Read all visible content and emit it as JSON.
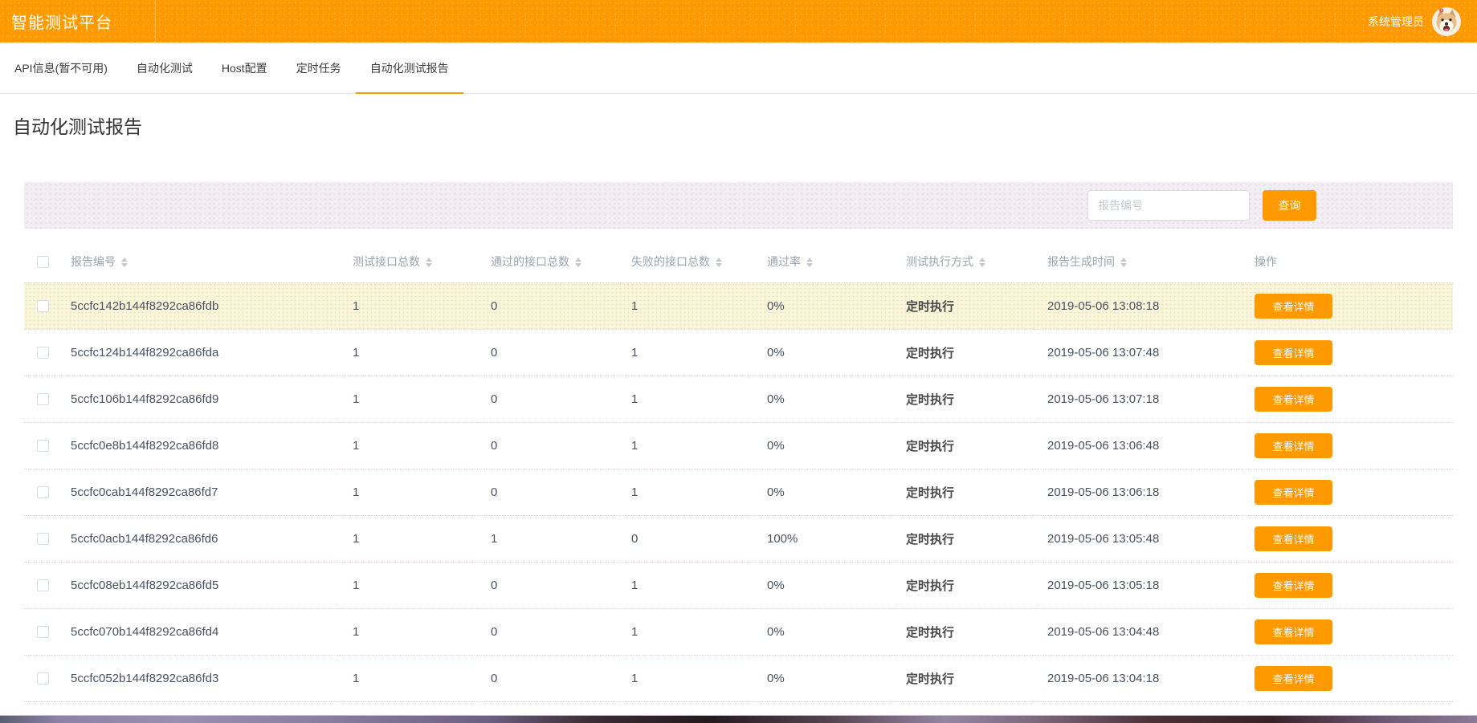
{
  "header": {
    "app_title": "智能测试平台",
    "user_name": "系统管理员",
    "avatar_icon": "dog-avatar"
  },
  "tabs": [
    {
      "label": "API信息(暂不可用)",
      "active": false
    },
    {
      "label": "自动化测试",
      "active": false
    },
    {
      "label": "Host配置",
      "active": false
    },
    {
      "label": "定时任务",
      "active": false
    },
    {
      "label": "自动化测试报告",
      "active": true
    }
  ],
  "page": {
    "title": "自动化测试报告"
  },
  "filter": {
    "input_placeholder": "报告编号",
    "input_value": "",
    "search_button_label": "查询"
  },
  "table": {
    "columns": [
      {
        "label": "报告编号",
        "sortable": true
      },
      {
        "label": "测试接口总数",
        "sortable": true
      },
      {
        "label": "通过的接口总数",
        "sortable": true
      },
      {
        "label": "失败的接口总数",
        "sortable": true
      },
      {
        "label": "通过率",
        "sortable": true
      },
      {
        "label": "测试执行方式",
        "sortable": true
      },
      {
        "label": "报告生成时间",
        "sortable": true
      },
      {
        "label": "操作",
        "sortable": false
      }
    ],
    "action_label": "查看详情",
    "rows": [
      {
        "id": "5ccfc142b144f8292ca86fdb",
        "total": "1",
        "passed": "0",
        "failed": "1",
        "rate": "0%",
        "exec": "定时执行",
        "time": "2019-05-06 13:08:18",
        "highlighted": true
      },
      {
        "id": "5ccfc124b144f8292ca86fda",
        "total": "1",
        "passed": "0",
        "failed": "1",
        "rate": "0%",
        "exec": "定时执行",
        "time": "2019-05-06 13:07:48",
        "highlighted": false
      },
      {
        "id": "5ccfc106b144f8292ca86fd9",
        "total": "1",
        "passed": "0",
        "failed": "1",
        "rate": "0%",
        "exec": "定时执行",
        "time": "2019-05-06 13:07:18",
        "highlighted": false
      },
      {
        "id": "5ccfc0e8b144f8292ca86fd8",
        "total": "1",
        "passed": "0",
        "failed": "1",
        "rate": "0%",
        "exec": "定时执行",
        "time": "2019-05-06 13:06:48",
        "highlighted": false
      },
      {
        "id": "5ccfc0cab144f8292ca86fd7",
        "total": "1",
        "passed": "0",
        "failed": "1",
        "rate": "0%",
        "exec": "定时执行",
        "time": "2019-05-06 13:06:18",
        "highlighted": false
      },
      {
        "id": "5ccfc0acb144f8292ca86fd6",
        "total": "1",
        "passed": "1",
        "failed": "0",
        "rate": "100%",
        "exec": "定时执行",
        "time": "2019-05-06 13:05:48",
        "highlighted": false
      },
      {
        "id": "5ccfc08eb144f8292ca86fd5",
        "total": "1",
        "passed": "0",
        "failed": "1",
        "rate": "0%",
        "exec": "定时执行",
        "time": "2019-05-06 13:05:18",
        "highlighted": false
      },
      {
        "id": "5ccfc070b144f8292ca86fd4",
        "total": "1",
        "passed": "0",
        "failed": "1",
        "rate": "0%",
        "exec": "定时执行",
        "time": "2019-05-06 13:04:48",
        "highlighted": false
      },
      {
        "id": "5ccfc052b144f8292ca86fd3",
        "total": "1",
        "passed": "0",
        "failed": "1",
        "rate": "0%",
        "exec": "定时执行",
        "time": "2019-05-06 13:04:18",
        "highlighted": false
      }
    ]
  },
  "colors": {
    "accent": "#ff9900",
    "header_bg": "#ff9900",
    "filter_bar_bg": "#f2eef3",
    "highlight_row_bg": "#faf6dc"
  }
}
